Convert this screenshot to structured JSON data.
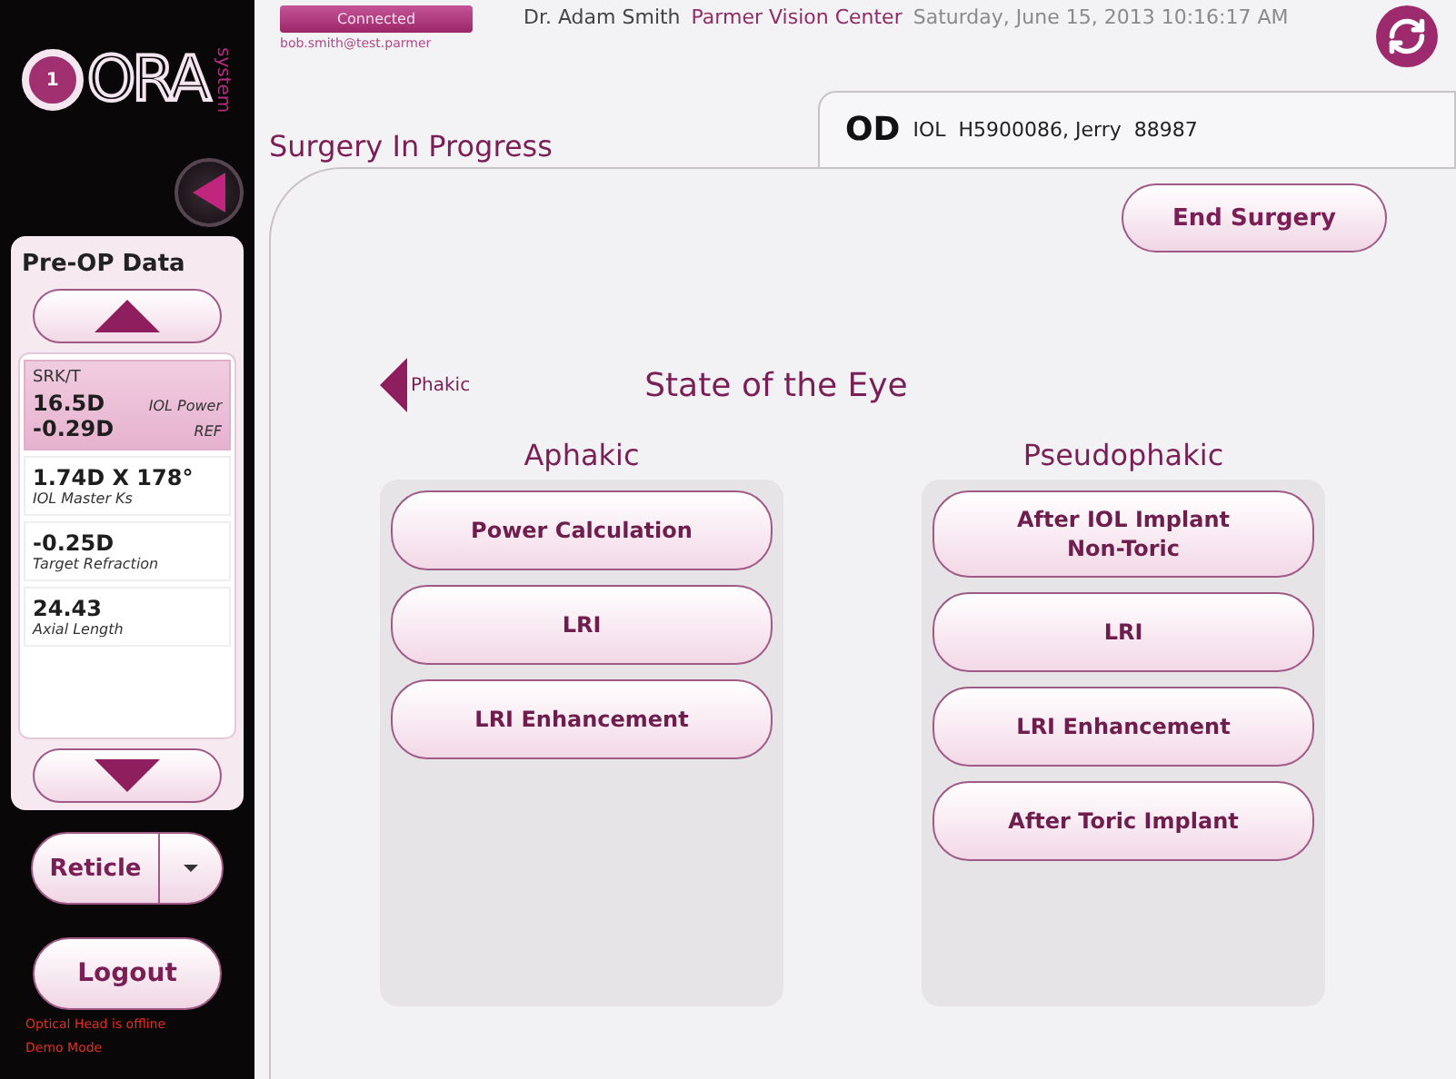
{
  "logo": {
    "badge": "1",
    "name": "ORA",
    "tag": "system"
  },
  "header": {
    "connection": "Connected",
    "user_email": "bob.smith@test.parmer",
    "doctor": "Dr. Adam Smith",
    "clinic": "Parmer Vision Center",
    "datetime": "Saturday, June 15, 2013 10:16:17 AM"
  },
  "page_title": "Surgery In Progress",
  "patient": {
    "eye": "OD",
    "lens": "IOL",
    "info": "H5900086, Jerry  88987"
  },
  "preop": {
    "title": "Pre-OP Data",
    "items": [
      {
        "kind": "formula",
        "selected": true,
        "heading": "SRK/T",
        "lines": [
          {
            "value": "16.5D",
            "label": "IOL Power"
          },
          {
            "value": "-0.29D",
            "label": "REF"
          }
        ]
      },
      {
        "kind": "stacked",
        "selected": false,
        "lines": [
          {
            "value": "1.74D X 178°",
            "label": "IOL Master Ks"
          }
        ]
      },
      {
        "kind": "stacked",
        "selected": false,
        "lines": [
          {
            "value": "-0.25D",
            "label": "Target Refraction"
          }
        ]
      },
      {
        "kind": "stacked",
        "selected": false,
        "lines": [
          {
            "value": "24.43",
            "label": "Axial Length"
          }
        ]
      }
    ]
  },
  "reticle_button": "Reticle",
  "logout_button": "Logout",
  "status_messages": [
    "Optical Head is offline",
    "Demo Mode"
  ],
  "end_surgery_button": "End Surgery",
  "back_link": "Phakic",
  "section_title": "State of the Eye",
  "columns": [
    {
      "title": "Aphakic",
      "buttons": [
        [
          "Power Calculation"
        ],
        [
          "LRI"
        ],
        [
          "LRI Enhancement"
        ]
      ]
    },
    {
      "title": "Pseudophakic",
      "buttons": [
        [
          "After IOL Implant",
          "Non-Toric"
        ],
        [
          "LRI"
        ],
        [
          "LRI Enhancement"
        ],
        [
          "After Toric Implant"
        ]
      ]
    }
  ]
}
